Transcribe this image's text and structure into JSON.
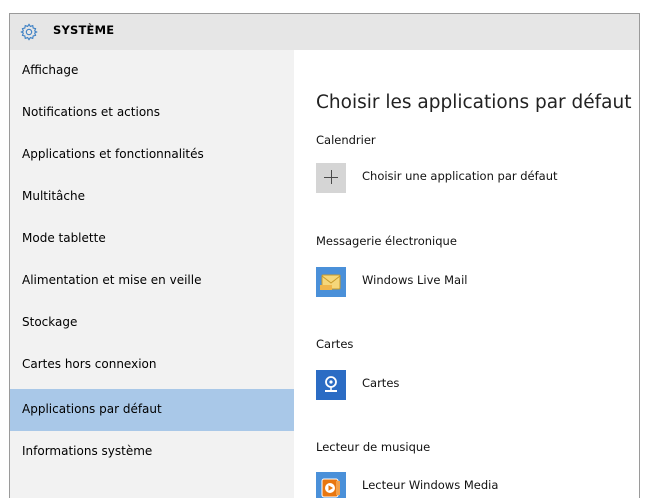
{
  "window": {
    "title": "SYSTÈME"
  },
  "sidebar": {
    "items": [
      {
        "label": "Affichage"
      },
      {
        "label": "Notifications et actions"
      },
      {
        "label": "Applications et fonctionnalités"
      },
      {
        "label": "Multitâche"
      },
      {
        "label": "Mode tablette"
      },
      {
        "label": "Alimentation et mise en veille"
      },
      {
        "label": "Stockage"
      },
      {
        "label": "Cartes hors connexion"
      },
      {
        "label": "Applications par défaut",
        "selected": true
      },
      {
        "label": "Informations système"
      }
    ]
  },
  "main": {
    "title": "Choisir les applications par défaut",
    "sections": [
      {
        "label": "Calendrier",
        "app": "Choisir une application par défaut",
        "icon": "plus-icon"
      },
      {
        "label": "Messagerie électronique",
        "app": "Windows Live Mail",
        "icon": "windows-live-mail-icon"
      },
      {
        "label": "Cartes",
        "app": "Cartes",
        "icon": "maps-icon"
      },
      {
        "label": "Lecteur de musique",
        "app": "Lecteur Windows Media",
        "icon": "windows-media-player-icon"
      }
    ]
  },
  "colors": {
    "selected": "#a9c8e8",
    "sidebar_bg": "#f2f2f2",
    "titlebar_bg": "#e6e6e6",
    "accent": "#3b7fc4"
  }
}
